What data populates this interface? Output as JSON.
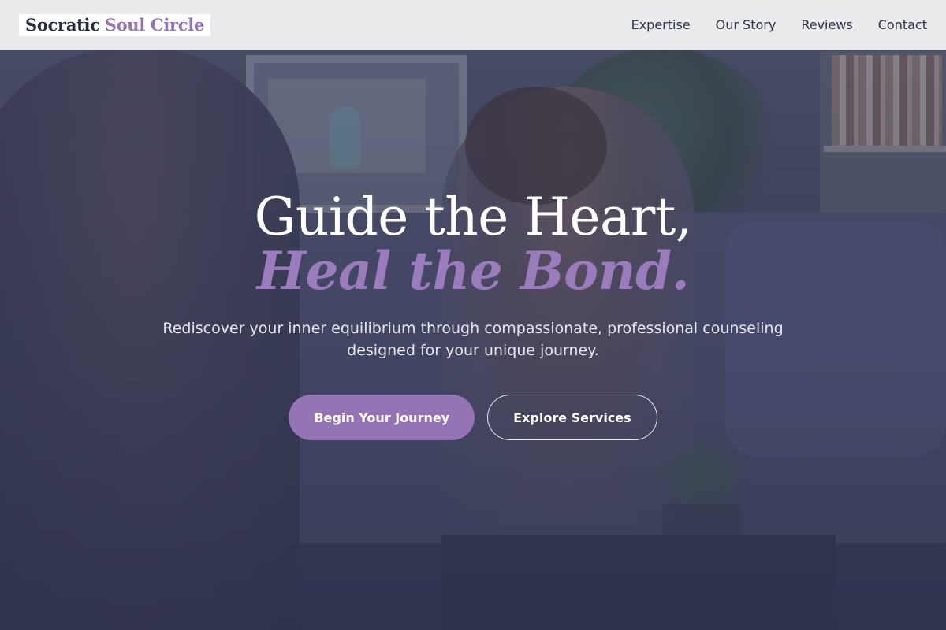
{
  "header": {
    "logo_primary": "Socratic",
    "logo_accent": "Soul Circle",
    "nav": [
      {
        "label": "Expertise"
      },
      {
        "label": "Our Story"
      },
      {
        "label": "Reviews"
      },
      {
        "label": "Contact"
      }
    ]
  },
  "hero": {
    "title_line1": "Guide the Heart,",
    "title_line2": "Heal the Bond.",
    "subtitle": "Rediscover your inner equilibrium through compassionate, professional counseling designed for your unique journey.",
    "primary_cta": "Begin Your Journey",
    "secondary_cta": "Explore Services"
  },
  "colors": {
    "accent": "#9474b4",
    "header_bg": "#f0f0f2",
    "text_dark": "#262b3f",
    "overlay": "#2c3150"
  }
}
